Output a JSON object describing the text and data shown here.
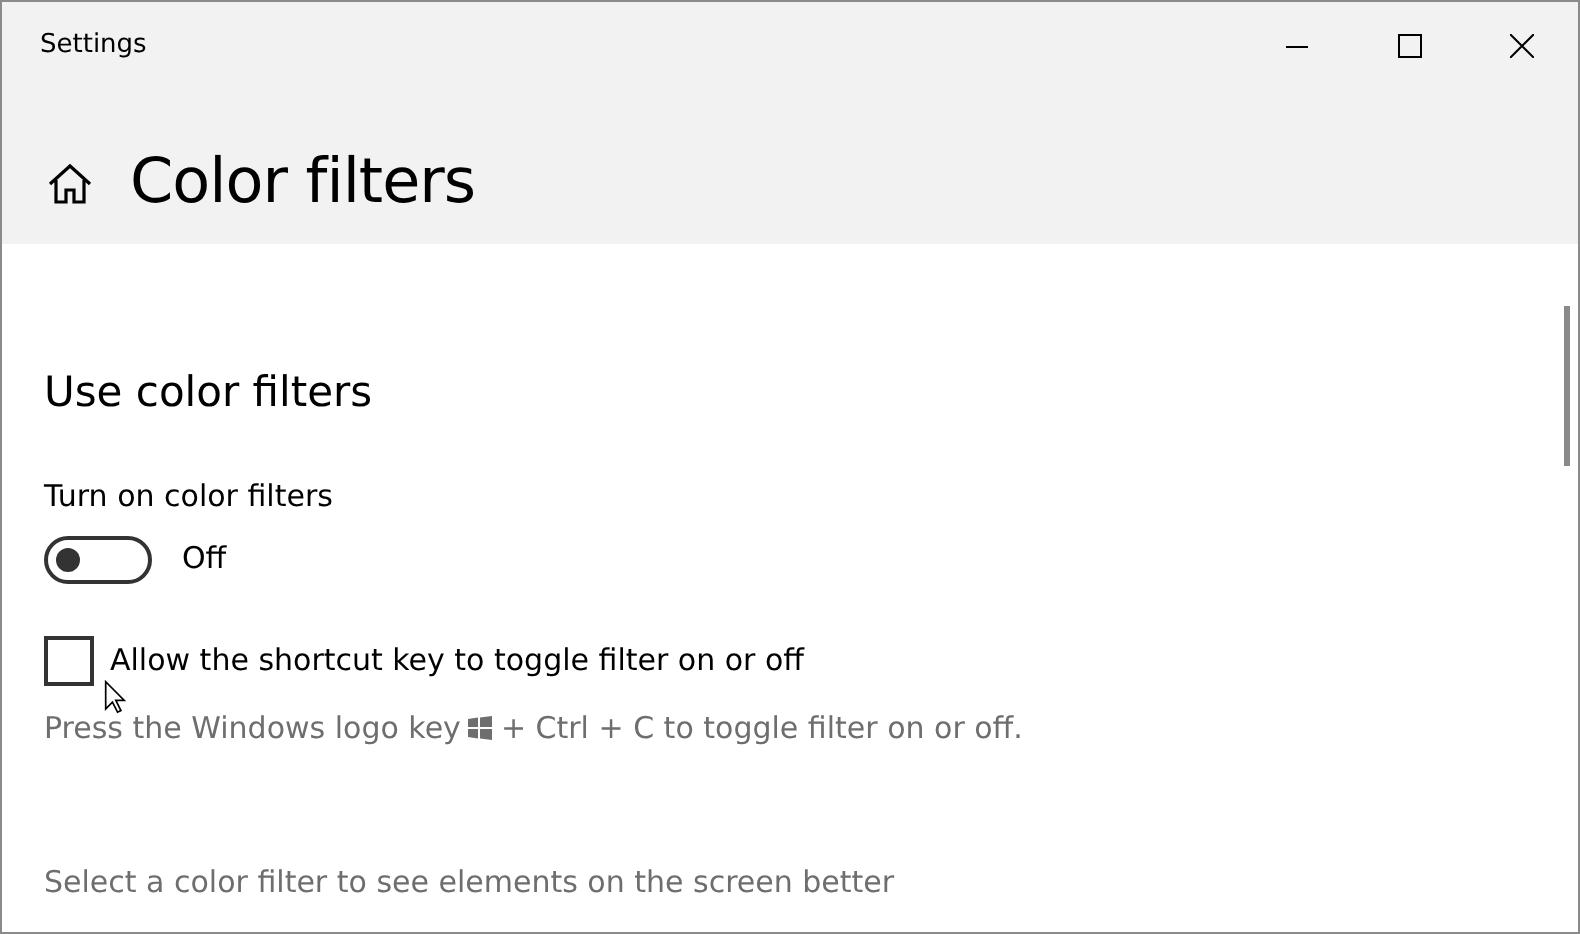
{
  "window": {
    "title": "Settings"
  },
  "page": {
    "title": "Color filters"
  },
  "section": {
    "title": "Use color filters"
  },
  "toggle": {
    "label": "Turn on color filters",
    "on": false,
    "state_text": "Off"
  },
  "shortcut": {
    "label": "Allow the shortcut key to toggle filter on or off",
    "checked": false
  },
  "hint": {
    "before": "Press the Windows logo key",
    "after": "+ Ctrl + C to toggle filter on or off."
  },
  "description": "Select a color filter to see elements on the screen better"
}
